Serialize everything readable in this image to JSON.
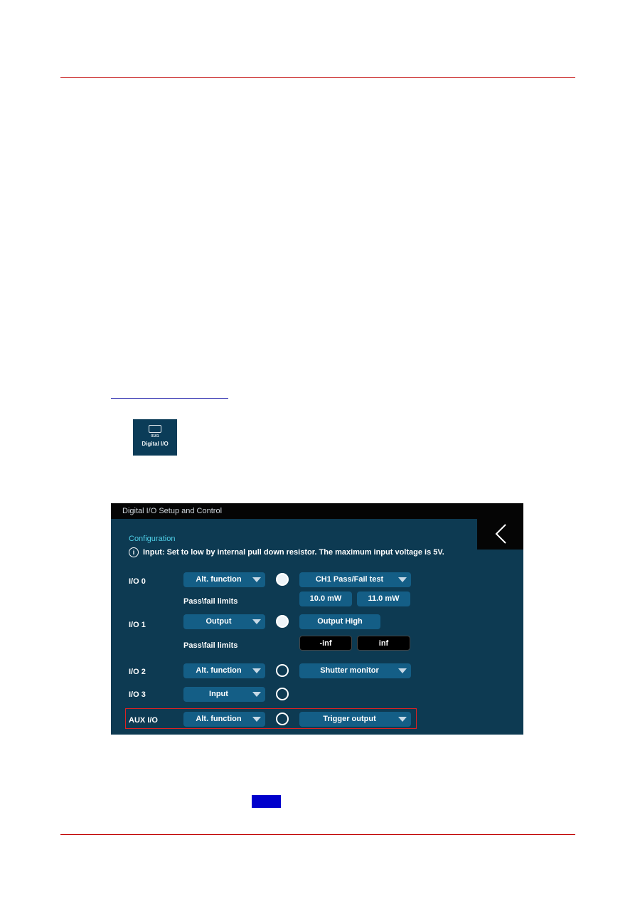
{
  "icon_tile": {
    "bits": "0101",
    "label": "Digital I/O"
  },
  "screen": {
    "title": "Digital I/O Setup and Control",
    "section": "Configuration",
    "info": "Input: Set to low by internal pull down resistor. The maximum input voltage is 5V.",
    "pass_fail_label": "Pass\\fail limits",
    "rows": [
      {
        "label": "I/O 0",
        "mode": "Alt. function",
        "state": "high",
        "function": "CH1 Pass/Fail test",
        "limits": [
          "10.0 mW",
          "11.0 mW"
        ]
      },
      {
        "label": "I/O 1",
        "mode": "Output",
        "state": "high",
        "function": "Output High",
        "limits": [
          "-inf",
          "inf"
        ]
      },
      {
        "label": "I/O 2",
        "mode": "Alt. function",
        "state": "low",
        "function": "Shutter monitor"
      },
      {
        "label": "I/O 3",
        "mode": "Input",
        "state": "low"
      },
      {
        "label": "AUX I/O",
        "mode": "Alt. function",
        "state": "low",
        "function": "Trigger output"
      }
    ]
  },
  "colors": {
    "rule": "#c00000",
    "screen_bg": "#0d3a52",
    "dropdown": "#145e86",
    "accent": "#4fd0e8",
    "highlight": "#dd2222"
  }
}
